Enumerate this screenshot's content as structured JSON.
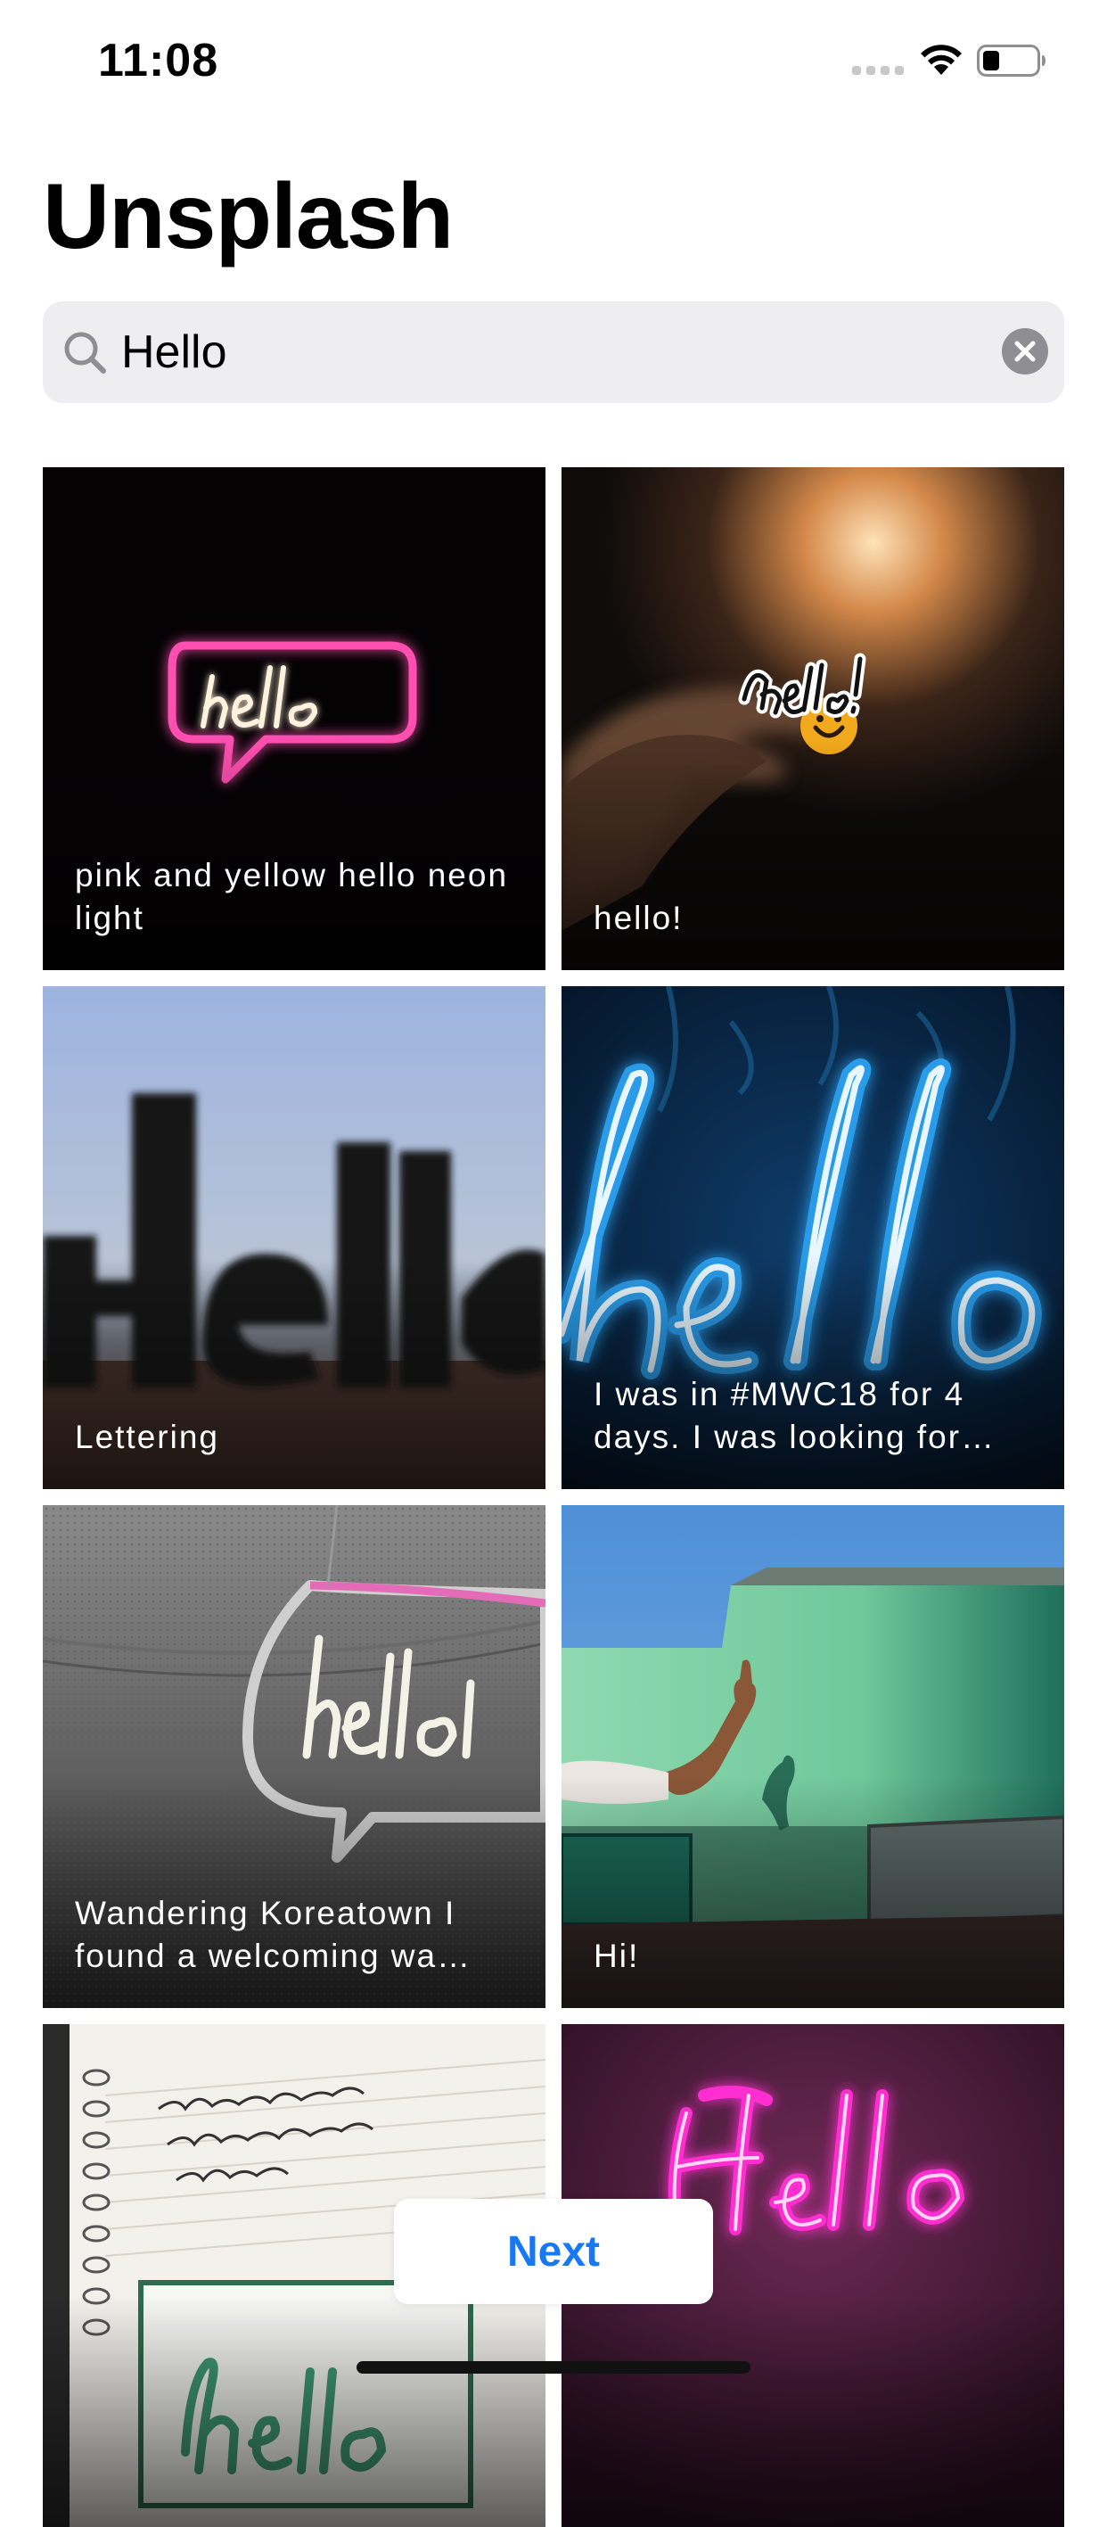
{
  "status_bar": {
    "time": "11:08",
    "wifi_icon": "wifi-icon",
    "battery_icon": "battery-icon"
  },
  "header": {
    "title": "Unsplash"
  },
  "search": {
    "value": "Hello",
    "icon": "search-icon",
    "clear_icon": "clear-icon"
  },
  "photos": [
    {
      "caption": "pink and yellow hello neon light"
    },
    {
      "caption": "hello!"
    },
    {
      "caption": "Lettering"
    },
    {
      "caption": "I was in #MWC18 for 4 days. I was looking for…"
    },
    {
      "caption": "Wandering Koreatown I found a welcoming wa…"
    },
    {
      "caption": "Hi!"
    },
    {
      "caption": ""
    },
    {
      "caption": ""
    }
  ],
  "footer": {
    "next_label": "Next"
  },
  "colors": {
    "accent": "#1877f2",
    "search_bg": "#eeeef1",
    "clear_bg": "#8e8e93"
  }
}
